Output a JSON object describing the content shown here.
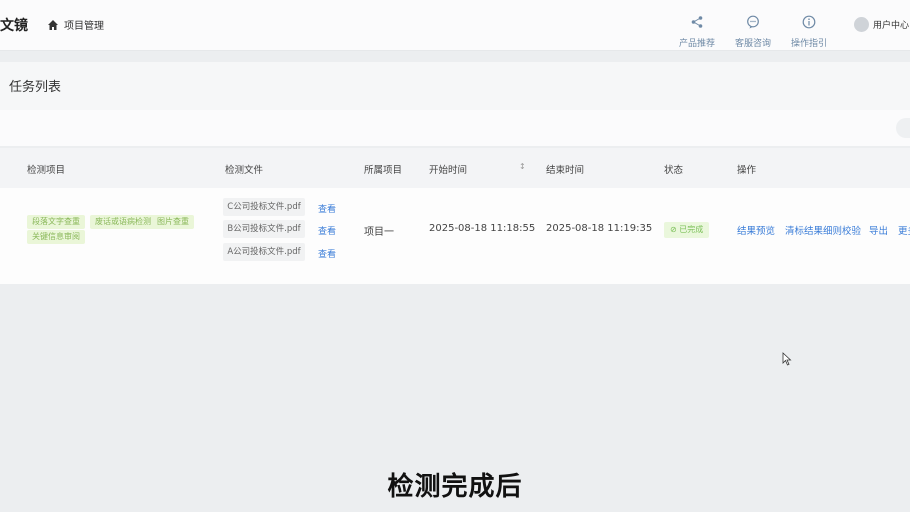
{
  "header": {
    "brand": "文镜",
    "home_label": "项目管理",
    "nav": [
      {
        "label": "产品推荐",
        "icon": "share-icon"
      },
      {
        "label": "客服咨询",
        "icon": "chat-icon"
      },
      {
        "label": "操作指引",
        "icon": "info-icon"
      }
    ],
    "user_label": "用户中心"
  },
  "page": {
    "title": "任务列表"
  },
  "table": {
    "columns": [
      "检测项目",
      "检测文件",
      "所属项目",
      "开始时间",
      "结束时间",
      "状态",
      "操作"
    ],
    "sort_icon": "↕",
    "row": {
      "tags": [
        "段落文字查重",
        "废话或语病检测",
        "图片查重",
        "关键信息审阅"
      ],
      "files": [
        {
          "name": "C公司投标文件.pdf",
          "action": "查看"
        },
        {
          "name": "B公司投标文件.pdf",
          "action": "查看"
        },
        {
          "name": "A公司投标文件.pdf",
          "action": "查看"
        }
      ],
      "project": "项目一",
      "start_time": "2025-08-18 11:18:55",
      "end_time": "2025-08-18 11:19:35",
      "status": "已完成",
      "actions": [
        "结果预览",
        "清标结果细则校验",
        "导出",
        "更多"
      ]
    }
  },
  "subtitle": "检测完成后",
  "colors": {
    "link": "#3b7dd8",
    "tag_bg": "#eaf6d8",
    "tag_text": "#8ab85a",
    "status_bg": "#eaf7dc"
  }
}
